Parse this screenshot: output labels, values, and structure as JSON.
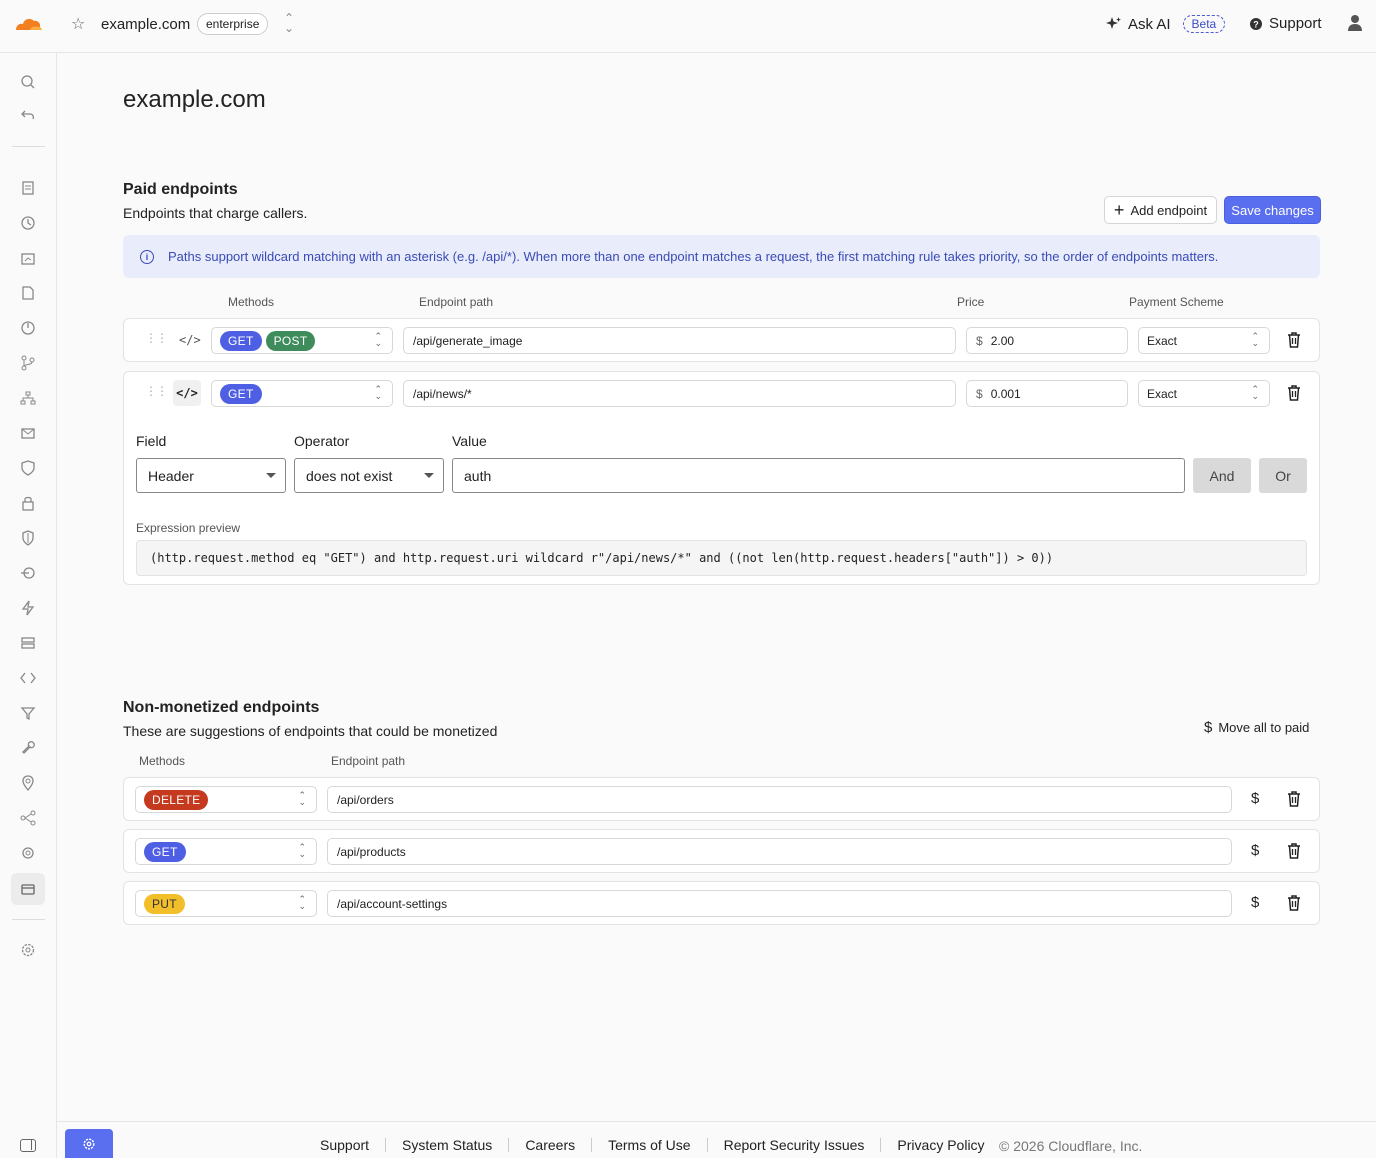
{
  "header": {
    "domain": "example.com",
    "plan": "enterprise",
    "ask_ai": "Ask AI",
    "beta": "Beta",
    "support": "Support"
  },
  "page": {
    "title": "example.com"
  },
  "paid": {
    "title": "Paid endpoints",
    "subtitle": "Endpoints that charge callers.",
    "add_button": "Add endpoint",
    "save_button": "Save changes",
    "info": "Paths support wildcard matching with an asterisk (e.g. /api/*). When more than one endpoint matches a request, the first matching rule takes priority, so the order of endpoints matters.",
    "columns": {
      "methods": "Methods",
      "path": "Endpoint path",
      "price": "Price",
      "scheme": "Payment Scheme"
    },
    "rows": [
      {
        "methods": [
          "GET",
          "POST"
        ],
        "path": "/api/generate_image",
        "currency": "$",
        "price": "2.00",
        "scheme": "Exact"
      },
      {
        "methods": [
          "GET"
        ],
        "path": "/api/news/*",
        "currency": "$",
        "price": "0.001",
        "scheme": "Exact"
      }
    ],
    "filter": {
      "field_label": "Field",
      "operator_label": "Operator",
      "value_label": "Value",
      "field": "Header",
      "operator": "does not exist",
      "value": "auth",
      "and_button": "And",
      "or_button": "Or",
      "preview_label": "Expression preview",
      "preview": "(http.request.method eq \"GET\") and http.request.uri wildcard r\"/api/news/*\" and ((not len(http.request.headers[\"auth\"]) > 0))"
    }
  },
  "nonmonetized": {
    "title": "Non-monetized endpoints",
    "subtitle": "These are suggestions of endpoints that could be monetized",
    "move_all": "Move all to paid",
    "columns": {
      "methods": "Methods",
      "path": "Endpoint path"
    },
    "rows": [
      {
        "method": "DELETE",
        "path": "/api/orders"
      },
      {
        "method": "GET",
        "path": "/api/products"
      },
      {
        "method": "PUT",
        "path": "/api/account-settings"
      }
    ]
  },
  "footer": {
    "links": [
      "Support",
      "System Status",
      "Careers",
      "Terms of Use",
      "Report Security Issues",
      "Privacy Policy"
    ],
    "copyright": "© 2026 Cloudflare, Inc."
  },
  "colors": {
    "primary": "#5a6ef0",
    "get": "#4f5fe3",
    "post": "#3e8b5b",
    "delete": "#c5391e",
    "put": "#f2be2a",
    "brand": "#f38020"
  }
}
